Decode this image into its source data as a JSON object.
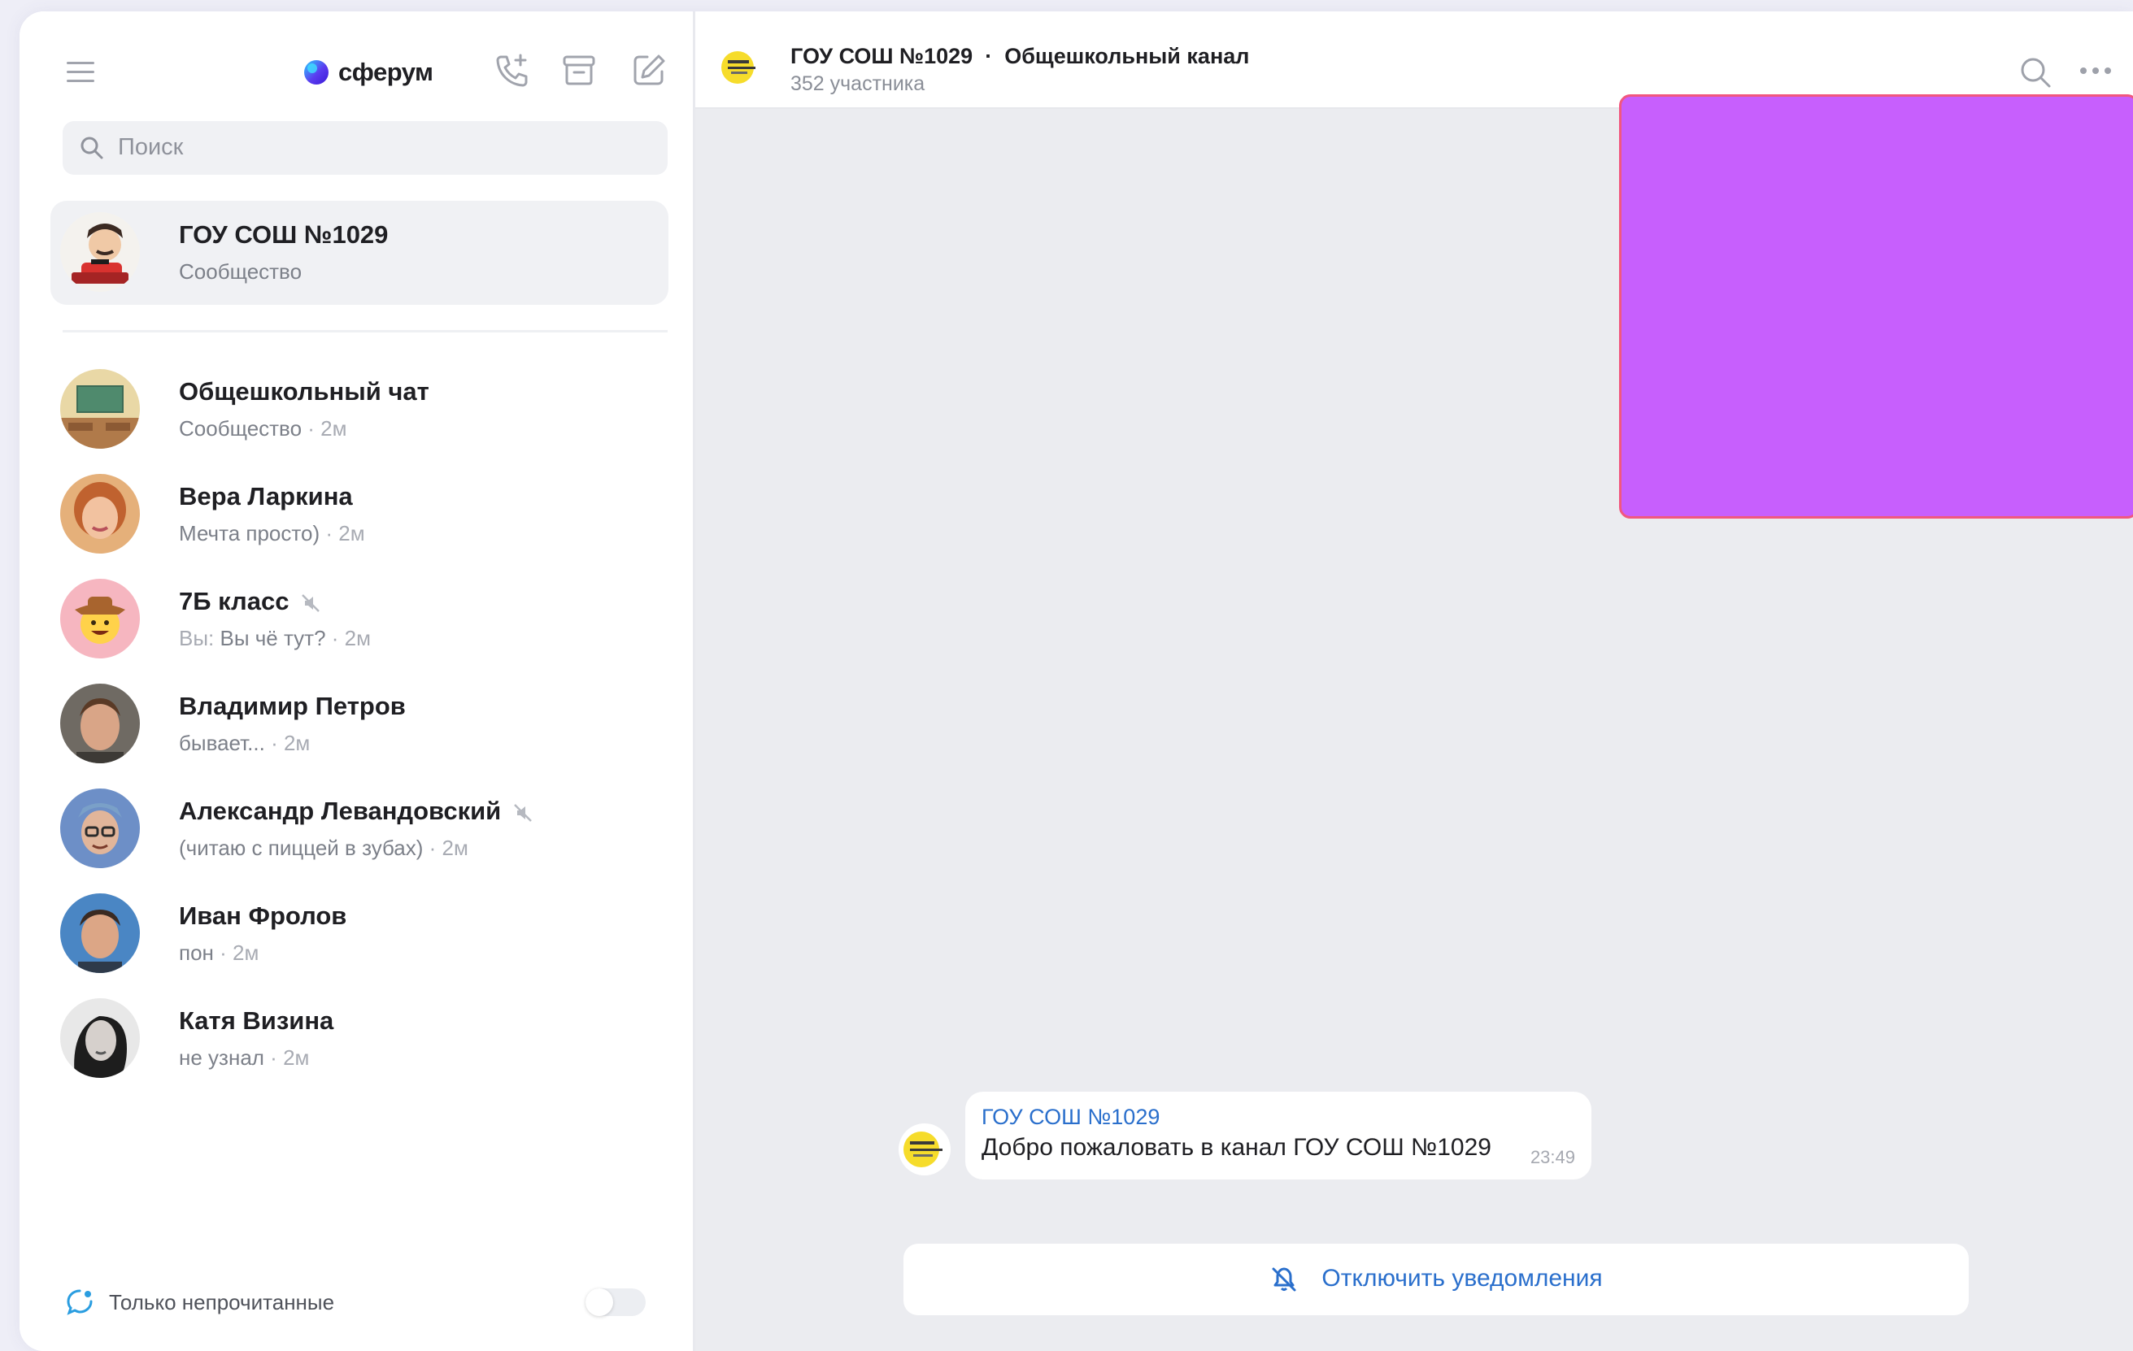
{
  "app": {
    "logo_text": "сферум"
  },
  "sidebar": {
    "search_placeholder": "Поиск",
    "pinned": {
      "title": "ГОУ СОШ №1029",
      "subtitle": "Сообщество"
    },
    "chats": [
      {
        "title": "Общешкольный чат",
        "preview": "Сообщество",
        "time": "2м",
        "muted": false
      },
      {
        "title": "Вера Ларкина",
        "preview": "Мечта просто)",
        "time": "2м",
        "muted": false
      },
      {
        "title": "7Б класс",
        "sender": "Вы:",
        "preview": "Вы чё тут?",
        "time": "2м",
        "muted": true
      },
      {
        "title": "Владимир Петров",
        "preview": "бывает...",
        "time": "2м",
        "muted": false
      },
      {
        "title": "Александр Левандовский",
        "preview": "(читаю с пиццей в зубах)",
        "time": "2м",
        "muted": true
      },
      {
        "title": "Иван Фролов",
        "preview": "пон",
        "time": "2м",
        "muted": false
      },
      {
        "title": "Катя Визина",
        "preview": "не узнал",
        "time": "2м",
        "muted": false
      }
    ],
    "footer": {
      "unread_only_label": "Только непрочитанные",
      "unread_only_enabled": false
    }
  },
  "channel": {
    "name": "ГОУ СОШ №1029",
    "separator": "·",
    "channel_name": "Общешкольный канал",
    "members": "352 участника"
  },
  "messages": [
    {
      "author": "ГОУ СОШ №1029",
      "text": "Добро пожаловать в канал ГОУ СОШ №1029",
      "time": "23:49"
    }
  ],
  "actions": {
    "mute_label": "Отключить уведомления"
  },
  "colors": {
    "accent": "#2a6fcc",
    "overlay": "#c75ffd",
    "overlay_border": "#f1577f"
  }
}
